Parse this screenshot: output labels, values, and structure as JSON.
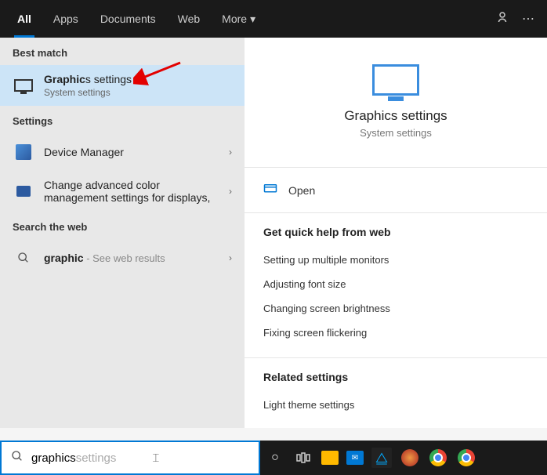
{
  "tabs": {
    "all": "All",
    "apps": "Apps",
    "documents": "Documents",
    "web": "Web",
    "more": "More"
  },
  "sections": {
    "best_match": "Best match",
    "settings": "Settings",
    "search_web": "Search the web"
  },
  "results": {
    "graphics": {
      "title_bold": "Graphic",
      "title_rest": "s settings",
      "subtitle": "System settings"
    },
    "device_manager": {
      "title": "Device Manager"
    },
    "color_mgmt": {
      "title": "Change advanced color management settings for displays,"
    },
    "web": {
      "title_bold": "graphic",
      "hint": " - See web results"
    }
  },
  "detail": {
    "title": "Graphics settings",
    "subtitle": "System settings",
    "open": "Open",
    "quick_help_header": "Get quick help from web",
    "links": [
      "Setting up multiple monitors",
      "Adjusting font size",
      "Changing screen brightness",
      "Fixing screen flickering"
    ],
    "related_header": "Related settings",
    "related_links": [
      "Light theme settings"
    ]
  },
  "search": {
    "typed": "graphics",
    "suggest": " settings"
  },
  "taskbar": {
    "items": [
      "cortana",
      "task-view",
      "explorer",
      "mail",
      "predator",
      "app1",
      "chrome",
      "chrome2"
    ]
  }
}
